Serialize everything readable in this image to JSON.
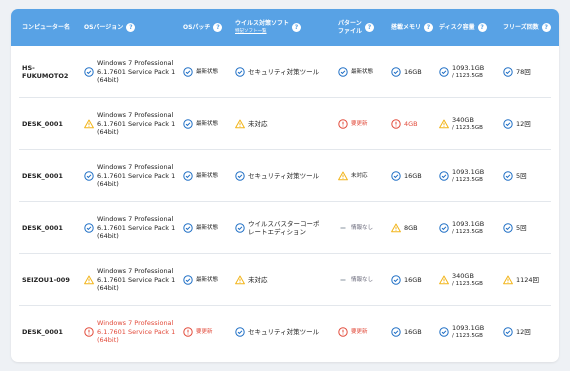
{
  "colors": {
    "header_bg": "#58a2e5",
    "ok": "#1f6fc5",
    "warn": "#f2b51c",
    "error": "#e24b3b"
  },
  "headers": {
    "computer": "コンピューター名",
    "os_version": "OSバージョン",
    "os_patch": "OSパッチ",
    "antivirus": "ウイルス対策ソフト",
    "antivirus_link": "特記ソフト一覧",
    "pattern_line1": "パターン",
    "pattern_line2": "ファイル",
    "memory": "搭載メモリ",
    "disk": "ディスク容量",
    "freeze": "フリーズ回数",
    "help_glyph": "?"
  },
  "rows": [
    {
      "name": "HS-FUKUMOTO2",
      "os": {
        "status": "ok",
        "line1": "Windows 7 Professional",
        "line2": "6.1.7601 Service Pack 1",
        "line3": "(64bit)"
      },
      "patch": {
        "status": "ok",
        "text": "最新状態"
      },
      "av": {
        "status": "ok",
        "line1": "セキュリティ対策ツール",
        "line2": ""
      },
      "pattern": {
        "status": "ok",
        "text": "最新状態"
      },
      "memory": {
        "status": "ok",
        "text": "16GB"
      },
      "disk": {
        "status": "ok",
        "used": "1093.1GB",
        "total": "/ 1123.5GB"
      },
      "freeze": {
        "status": "ok",
        "text": "78回"
      }
    },
    {
      "name": "DESK_0001",
      "os": {
        "status": "warn",
        "line1": "Windows 7 Professional",
        "line2": "6.1.7601 Service Pack 1",
        "line3": "(64bit)"
      },
      "patch": {
        "status": "ok",
        "text": "最新状態"
      },
      "av": {
        "status": "warn",
        "line1": "未対応",
        "line2": ""
      },
      "pattern": {
        "status": "error",
        "text": "要更新"
      },
      "memory": {
        "status": "error",
        "text": "4GB"
      },
      "disk": {
        "status": "warn",
        "used": "340GB",
        "total": "/ 1123.5GB"
      },
      "freeze": {
        "status": "ok",
        "text": "12回"
      }
    },
    {
      "name": "DESK_0001",
      "os": {
        "status": "ok",
        "line1": "Windows 7 Professional",
        "line2": "6.1.7601 Service Pack 1",
        "line3": "(64bit)"
      },
      "patch": {
        "status": "ok",
        "text": "最新状態"
      },
      "av": {
        "status": "ok",
        "line1": "セキュリティ対策ツール",
        "line2": ""
      },
      "pattern": {
        "status": "warn",
        "text": "未対応"
      },
      "memory": {
        "status": "ok",
        "text": "16GB"
      },
      "disk": {
        "status": "ok",
        "used": "1093.1GB",
        "total": "/ 1123.5GB"
      },
      "freeze": {
        "status": "ok",
        "text": "5回"
      }
    },
    {
      "name": "DESK_0001",
      "os": {
        "status": "ok",
        "line1": "Windows 7 Professional",
        "line2": "6.1.7601 Service Pack 1",
        "line3": "(64bit)"
      },
      "patch": {
        "status": "ok",
        "text": "最新状態"
      },
      "av": {
        "status": "ok",
        "line1": "ウイルスバスターコーポ",
        "line2": "レートエディション"
      },
      "pattern": {
        "status": "none",
        "text": "情報なし"
      },
      "memory": {
        "status": "warn",
        "text": "8GB"
      },
      "disk": {
        "status": "ok",
        "used": "1093.1GB",
        "total": "/ 1123.5GB"
      },
      "freeze": {
        "status": "ok",
        "text": "5回"
      }
    },
    {
      "name": "SEIZOU1-009",
      "os": {
        "status": "warn",
        "line1": "Windows 7 Professional",
        "line2": "6.1.7601 Service Pack 1",
        "line3": "(64bit)"
      },
      "patch": {
        "status": "ok",
        "text": "最新状態"
      },
      "av": {
        "status": "warn",
        "line1": "未対応",
        "line2": ""
      },
      "pattern": {
        "status": "none",
        "text": "情報なし"
      },
      "memory": {
        "status": "ok",
        "text": "16GB"
      },
      "disk": {
        "status": "warn",
        "used": "340GB",
        "total": "/ 1123.5GB"
      },
      "freeze": {
        "status": "warn",
        "text": "1124回"
      }
    },
    {
      "name": "DESK_0001",
      "os": {
        "status": "error",
        "line1": "Windows 7 Professional",
        "line2": "6.1.7601 Service Pack 1",
        "line3": "(64bit)"
      },
      "patch": {
        "status": "error",
        "text": "要更新"
      },
      "av": {
        "status": "ok",
        "line1": "セキュリティ対策ツール",
        "line2": ""
      },
      "pattern": {
        "status": "error",
        "text": "要更新"
      },
      "memory": {
        "status": "ok",
        "text": "16GB"
      },
      "disk": {
        "status": "ok",
        "used": "1093.1GB",
        "total": "/ 1123.5GB"
      },
      "freeze": {
        "status": "ok",
        "text": "12回"
      }
    }
  ]
}
